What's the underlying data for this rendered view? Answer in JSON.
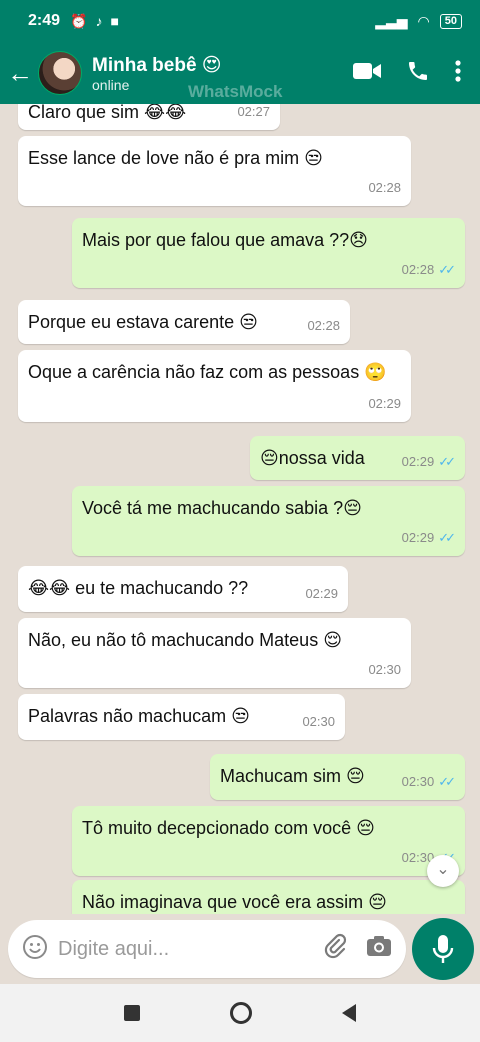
{
  "status_bar": {
    "time": "2:49",
    "battery": "50"
  },
  "header": {
    "contact_name": "Minha bebê 😍",
    "contact_status": "online",
    "watermark": "WhatsMock"
  },
  "messages": [
    {
      "dir": "in",
      "text": "Claro que sim 😂😂",
      "time": "02:27"
    },
    {
      "dir": "in",
      "text": "Esse lance de love não é pra mim 😒",
      "time": "02:28"
    },
    {
      "dir": "out",
      "text": "Mais por que falou que amava ??😞",
      "time": "02:28"
    },
    {
      "dir": "in",
      "text": "Porque eu estava carente 😒",
      "time": "02:28"
    },
    {
      "dir": "in",
      "text": "Oque a carência não faz com as pessoas 🙄",
      "time": "02:29"
    },
    {
      "dir": "out",
      "text": "😔nossa vida",
      "time": "02:29"
    },
    {
      "dir": "out",
      "text": "Você tá me machucando sabia ?😔",
      "time": "02:29"
    },
    {
      "dir": "in",
      "text": "😂😂 eu te machucando ??",
      "time": "02:29"
    },
    {
      "dir": "in",
      "text": "Não, eu não tô machucando Mateus 😌",
      "time": "02:30"
    },
    {
      "dir": "in",
      "text": "Palavras não machucam 😒",
      "time": "02:30"
    },
    {
      "dir": "out",
      "text": "Machucam sim 😔",
      "time": "02:30"
    },
    {
      "dir": "out",
      "text": "Tô muito decepcionado com você 😔",
      "time": "02:30"
    },
    {
      "dir": "out",
      "text": "Não imaginava que você era assim 😔",
      "time": ""
    }
  ],
  "composer": {
    "placeholder": "Digite aqui..."
  },
  "icons": {
    "back": "arrow-left",
    "video": "video-camera",
    "call": "phone",
    "menu": "dots-vertical",
    "emoji": "smiley",
    "attach": "paperclip",
    "camera": "camera",
    "mic": "microphone",
    "scroll": "chevron-double-down"
  },
  "colors": {
    "header": "#008069",
    "outgoing_bubble": "#dcf8c6",
    "incoming_bubble": "#ffffff",
    "read_ticks": "#4fb6ec"
  }
}
